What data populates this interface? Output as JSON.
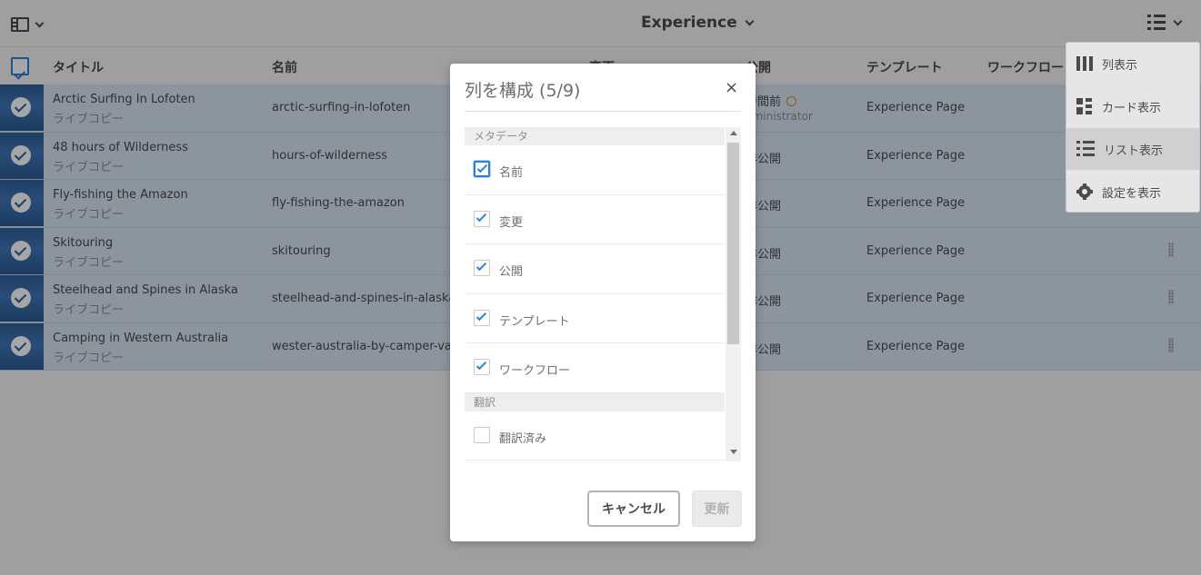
{
  "app": {
    "title": "Experience"
  },
  "table": {
    "headers": [
      "タイトル",
      "名前",
      "変更",
      "公開",
      "テンプレート",
      "ワークフロー"
    ],
    "rows": [
      {
        "title": "Arctic Surfing In Lofoten",
        "subtitle": "ライブコピー",
        "name": "arctic-surfing-in-lofoten",
        "publish": "時間前",
        "publish_by": "dministrator",
        "template": "Experience Page"
      },
      {
        "title": "48 hours of Wilderness",
        "subtitle": "ライブコピー",
        "name": "hours-of-wilderness",
        "publish": "非公開",
        "template": "Experience Page"
      },
      {
        "title": "Fly-fishing the Amazon",
        "subtitle": "ライブコピー",
        "name": "fly-fishing-the-amazon",
        "publish": "非公開",
        "template": "Experience Page"
      },
      {
        "title": "Skitouring",
        "subtitle": "ライブコピー",
        "name": "skitouring",
        "publish": "非公開",
        "template": "Experience Page"
      },
      {
        "title": "Steelhead and Spines in Alaska",
        "subtitle": "ライブコピー",
        "name": "steelhead-and-spines-in-alaska",
        "publish": "非公開",
        "template": "Experience Page"
      },
      {
        "title": "Camping in Western Australia",
        "subtitle": "ライブコピー",
        "name": "wester-australia-by-camper-van",
        "publish": "非公開",
        "template": "Experience Page"
      }
    ]
  },
  "view_menu": {
    "items": [
      {
        "label": "列表示",
        "icon": "column-view-icon"
      },
      {
        "label": "カード表示",
        "icon": "card-view-icon"
      },
      {
        "label": "リスト表示",
        "icon": "list-view-icon",
        "selected": true
      },
      {
        "label": "設定を表示",
        "icon": "gear-icon"
      }
    ]
  },
  "dialog": {
    "title": "列を構成 (5/9)",
    "close": "×",
    "section_metadata": "メタデータ",
    "section_translation": "翻訳",
    "items": [
      {
        "label": "名前",
        "checked": true
      },
      {
        "label": "変更",
        "checked": true
      },
      {
        "label": "公開",
        "checked": true
      },
      {
        "label": "テンプレート",
        "checked": true
      },
      {
        "label": "ワークフロー",
        "checked": true
      },
      {
        "label": "翻訳済み",
        "checked": false
      }
    ],
    "cancel_label": "キャンセル",
    "update_label": "更新"
  },
  "colors": {
    "accent": "#2680eb",
    "selected_row": "#d7e4f3",
    "overlay": "rgba(0,0,0,0.35)"
  }
}
